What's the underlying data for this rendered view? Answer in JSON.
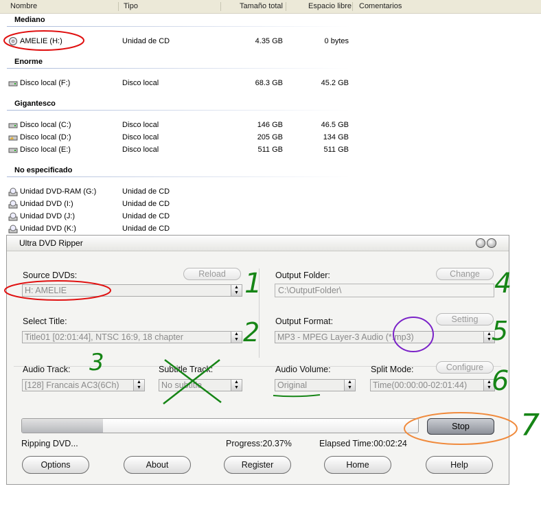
{
  "explorer": {
    "columns": [
      "Nombre",
      "Tipo",
      "Tamaño total",
      "Espacio libre",
      "Comentarios"
    ],
    "groups": [
      {
        "name": "Mediano",
        "items": [
          {
            "name": "AMELIE (H:)",
            "type": "Unidad de CD",
            "total": "4.35 GB",
            "free": "0 bytes",
            "icon": "cd-drive-icon"
          }
        ]
      },
      {
        "name": "Enorme",
        "items": [
          {
            "name": "Disco local (F:)",
            "type": "Disco local",
            "total": "68.3 GB",
            "free": "45.2 GB",
            "icon": "hard-drive-icon"
          }
        ]
      },
      {
        "name": "Gigantesco",
        "items": [
          {
            "name": "Disco local (C:)",
            "type": "Disco local",
            "total": "146 GB",
            "free": "46.5 GB",
            "icon": "hard-drive-icon"
          },
          {
            "name": "Disco local (D:)",
            "type": "Disco local",
            "total": "205 GB",
            "free": "134 GB",
            "icon": "hard-drive-icon"
          },
          {
            "name": "Disco local (E:)",
            "type": "Disco local",
            "total": "511 GB",
            "free": "511 GB",
            "icon": "hard-drive-icon"
          }
        ]
      },
      {
        "name": "No especificado",
        "items": [
          {
            "name": "Unidad DVD-RAM (G:)",
            "type": "Unidad de CD",
            "icon": "dvd-drive-icon"
          },
          {
            "name": "Unidad DVD (I:)",
            "type": "Unidad de CD",
            "icon": "dvd-drive-icon"
          },
          {
            "name": "Unidad DVD (J:)",
            "type": "Unidad de CD",
            "icon": "dvd-drive-icon"
          },
          {
            "name": "Unidad DVD (K:)",
            "type": "Unidad de CD",
            "icon": "dvd-drive-icon"
          }
        ]
      }
    ]
  },
  "ripper": {
    "title": "Ultra DVD Ripper",
    "source": {
      "label": "Source DVDs:",
      "reload": "Reload",
      "value": "H: AMELIE"
    },
    "title_select": {
      "label": "Select Title:",
      "value": "Title01 [02:01:44], NTSC 16:9, 18 chapter"
    },
    "audio_track": {
      "label": "Audio Track:",
      "value": "[128] Francais AC3(6Ch)"
    },
    "subtitle_track": {
      "label": "Subtitle Track:",
      "value": "No subtitle"
    },
    "output_folder": {
      "label": "Output Folder:",
      "change": "Change",
      "value": "C:\\OutputFolder\\"
    },
    "output_format": {
      "label": "Output Format:",
      "setting": "Setting",
      "value": "MP3 - MPEG Layer-3 Audio (*.mp3)"
    },
    "audio_volume": {
      "label": "Audio Volume:",
      "value": "Original"
    },
    "split_mode": {
      "label": "Split Mode:",
      "configure": "Configure",
      "value": "Time(00:00:00-02:01:44)"
    },
    "progress": {
      "fraction": 0.2037
    },
    "stop": "Stop",
    "status": "Ripping DVD...",
    "progress_text": "Progress:20.37%",
    "elapsed": "Elapsed Time:00:02:24",
    "buttons": {
      "options": "Options",
      "about": "About",
      "register": "Register",
      "home": "Home",
      "help": "Help"
    }
  },
  "annotations": {
    "n1": "1",
    "n2": "2",
    "n3": "3",
    "n4": "4",
    "n5": "5",
    "n6": "6",
    "n7": "7"
  },
  "colors": {
    "annotation_red": "#e01010",
    "annotation_green": "#168516",
    "annotation_purple": "#7a22c8",
    "annotation_orange": "#f08a3c"
  }
}
